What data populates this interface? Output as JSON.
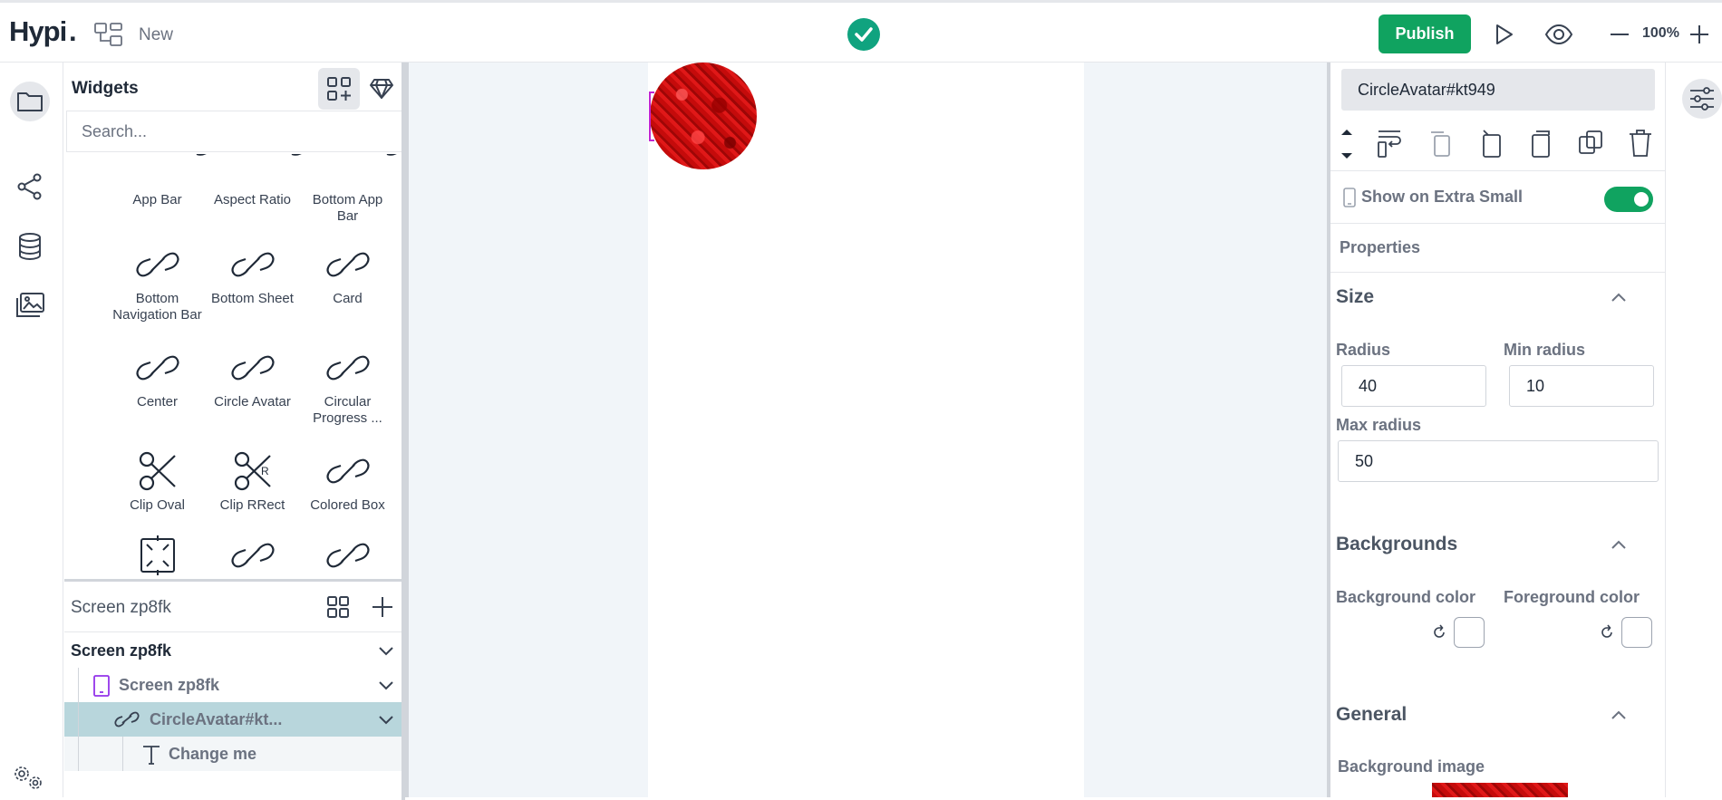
{
  "app": {
    "logo": "Hypi",
    "new_label": "New"
  },
  "toolbar": {
    "publish_label": "Publish",
    "zoom": "100%"
  },
  "widgets_panel": {
    "title": "Widgets",
    "search_placeholder": "Search...",
    "items": [
      {
        "label": "App Bar",
        "icon": "link-icon"
      },
      {
        "label": "Aspect Ratio",
        "icon": "link-icon"
      },
      {
        "label": "Bottom App Bar",
        "icon": "link-icon"
      },
      {
        "label": "Bottom Navigation Bar",
        "icon": "link-icon"
      },
      {
        "label": "Bottom Sheet",
        "icon": "link-icon"
      },
      {
        "label": "Card",
        "icon": "link-icon"
      },
      {
        "label": "Center",
        "icon": "link-icon"
      },
      {
        "label": "Circle Avatar",
        "icon": "link-icon"
      },
      {
        "label": "Circular Progress ...",
        "icon": "link-icon"
      },
      {
        "label": "Clip Oval",
        "icon": "scissors-icon"
      },
      {
        "label": "Clip RRect",
        "icon": "scissors-r-icon"
      },
      {
        "label": "Colored Box",
        "icon": "link-icon"
      },
      {
        "label": "",
        "icon": "expand-box-icon"
      },
      {
        "label": "",
        "icon": "link-icon"
      },
      {
        "label": "",
        "icon": "link-icon"
      }
    ]
  },
  "layers_panel": {
    "title": "Screen zp8fk",
    "rows": [
      {
        "label": "Screen zp8fk",
        "icon": ""
      },
      {
        "label": "Screen zp8fk",
        "icon": "phone-icon"
      },
      {
        "label": "CircleAvatar#kt...",
        "icon": "link-icon"
      },
      {
        "label": "Change me",
        "icon": "text-icon"
      }
    ]
  },
  "properties_panel": {
    "widget_name": "CircleAvatar#kt949",
    "show_on_label": "Show on Extra Small",
    "show_on_enabled": true,
    "properties_label": "Properties",
    "size": {
      "title": "Size",
      "radius_label": "Radius",
      "radius_value": "40",
      "min_radius_label": "Min radius",
      "min_radius_value": "10",
      "max_radius_label": "Max radius",
      "max_radius_value": "50"
    },
    "backgrounds": {
      "title": "Backgrounds",
      "bg_color_label": "Background color",
      "fg_color_label": "Foreground color"
    },
    "general": {
      "title": "General",
      "bg_image_label": "Background image"
    }
  },
  "colors": {
    "accent": "#10a360",
    "selected_row": "#b8d6dc",
    "avatar": "#d10f0f"
  }
}
